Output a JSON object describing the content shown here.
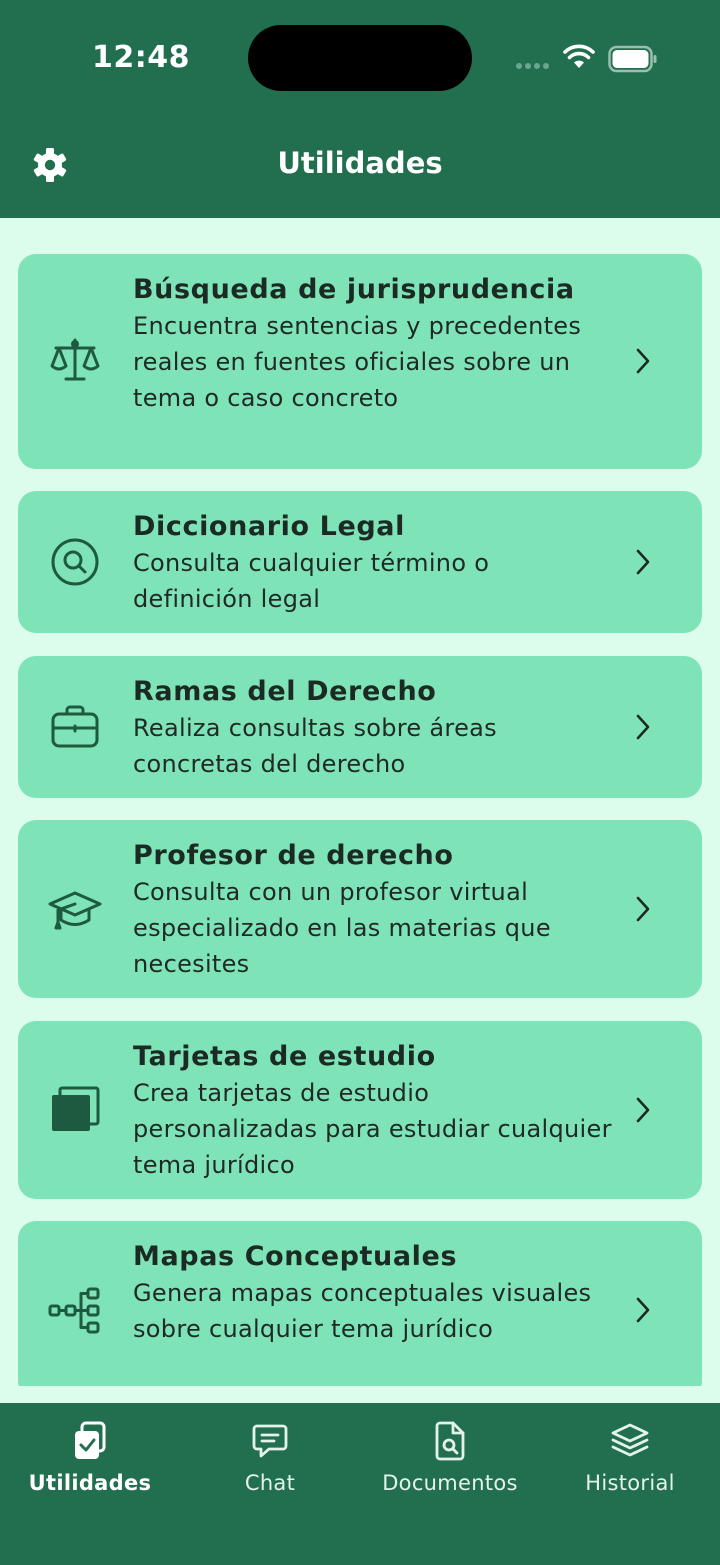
{
  "status": {
    "time": "12:48"
  },
  "header": {
    "title": "Utilidades"
  },
  "cards": [
    {
      "title": "Búsqueda de jurisprudencia",
      "desc": "Encuentra sentencias y precedentes reales en fuentes oficiales sobre un tema o caso concreto",
      "icon": "scale-icon"
    },
    {
      "title": "Diccionario Legal",
      "desc": "Consulta cualquier término o definición legal",
      "icon": "search-circle-icon"
    },
    {
      "title": "Ramas del Derecho",
      "desc": "Realiza consultas sobre áreas concretas del derecho",
      "icon": "briefcase-icon"
    },
    {
      "title": "Profesor de derecho",
      "desc": "Consulta con un profesor virtual especializado en las materias que necesites",
      "icon": "graduation-cap-icon"
    },
    {
      "title": "Tarjetas de estudio",
      "desc": "Crea tarjetas de estudio personalizadas para estudiar cualquier tema jurídico",
      "icon": "cards-icon"
    },
    {
      "title": "Mapas Conceptuales",
      "desc": "Genera mapas conceptuales visuales sobre cualquier tema jurídico",
      "icon": "mind-map-icon"
    }
  ],
  "tabs": [
    {
      "label": "Utilidades",
      "icon": "clipboard-check-icon",
      "active": true
    },
    {
      "label": "Chat",
      "icon": "chat-bubble-icon",
      "active": false
    },
    {
      "label": "Documentos",
      "icon": "document-search-icon",
      "active": false
    },
    {
      "label": "Historial",
      "icon": "layers-icon",
      "active": false
    }
  ],
  "colors": {
    "header_bg": "#226f50",
    "page_bg": "#dcfcec",
    "card_bg": "#7fe3b8",
    "icon_color": "#1d5a40",
    "text_dark": "#1c2a24"
  }
}
